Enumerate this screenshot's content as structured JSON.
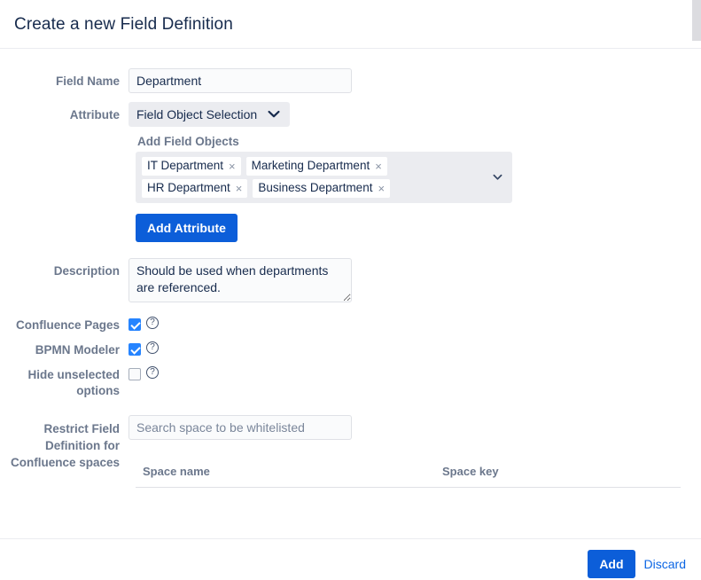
{
  "header": {
    "title": "Create a new Field Definition"
  },
  "form": {
    "field_name": {
      "label": "Field Name",
      "value": "Department",
      "placeholder": ""
    },
    "attribute": {
      "label": "Attribute",
      "selected": "Field Object Selection",
      "chevron_icon": "chevron-down-icon"
    },
    "field_objects": {
      "label": "Add Field Objects",
      "chevron_icon": "chevron-down-icon",
      "tags": [
        {
          "label": "IT Department",
          "remove_icon": "close-icon",
          "remove_glyph": "×"
        },
        {
          "label": "Marketing Department",
          "remove_icon": "close-icon",
          "remove_glyph": "×"
        },
        {
          "label": "HR Department",
          "remove_icon": "close-icon",
          "remove_glyph": "×"
        },
        {
          "label": "Business Department",
          "remove_icon": "close-icon",
          "remove_glyph": "×"
        }
      ]
    },
    "add_attribute_label": "Add Attribute",
    "description": {
      "label": "Description",
      "value": "Should be used when departments are referenced.",
      "placeholder": ""
    },
    "confluence_pages": {
      "label": "Confluence Pages",
      "checked": true,
      "help_icon": "help-circle-icon",
      "help_glyph": "?"
    },
    "bpmn_modeler": {
      "label": "BPMN Modeler",
      "checked": true,
      "help_icon": "help-circle-icon",
      "help_glyph": "?"
    },
    "hide_unselected": {
      "label": "Hide unselected options",
      "checked": false,
      "help_icon": "help-circle-icon",
      "help_glyph": "?"
    },
    "restrict": {
      "label": "Restrict Field Definition for Confluence spaces",
      "value": "",
      "placeholder": "Search space to be whitelisted"
    }
  },
  "space_table": {
    "columns": [
      "Space name",
      "Space key"
    ],
    "rows": []
  },
  "footer": {
    "add_label": "Add",
    "discard_label": "Discard"
  },
  "colors": {
    "primary_button": "#0C5ED9",
    "link": "#0C66E4",
    "checkbox_checked": "#2684FF",
    "label_text": "#6B778C",
    "title_text": "#172B4D",
    "field_bg": "#EBECF0",
    "input_bg": "#FAFBFC",
    "border": "#DFE1E6"
  }
}
